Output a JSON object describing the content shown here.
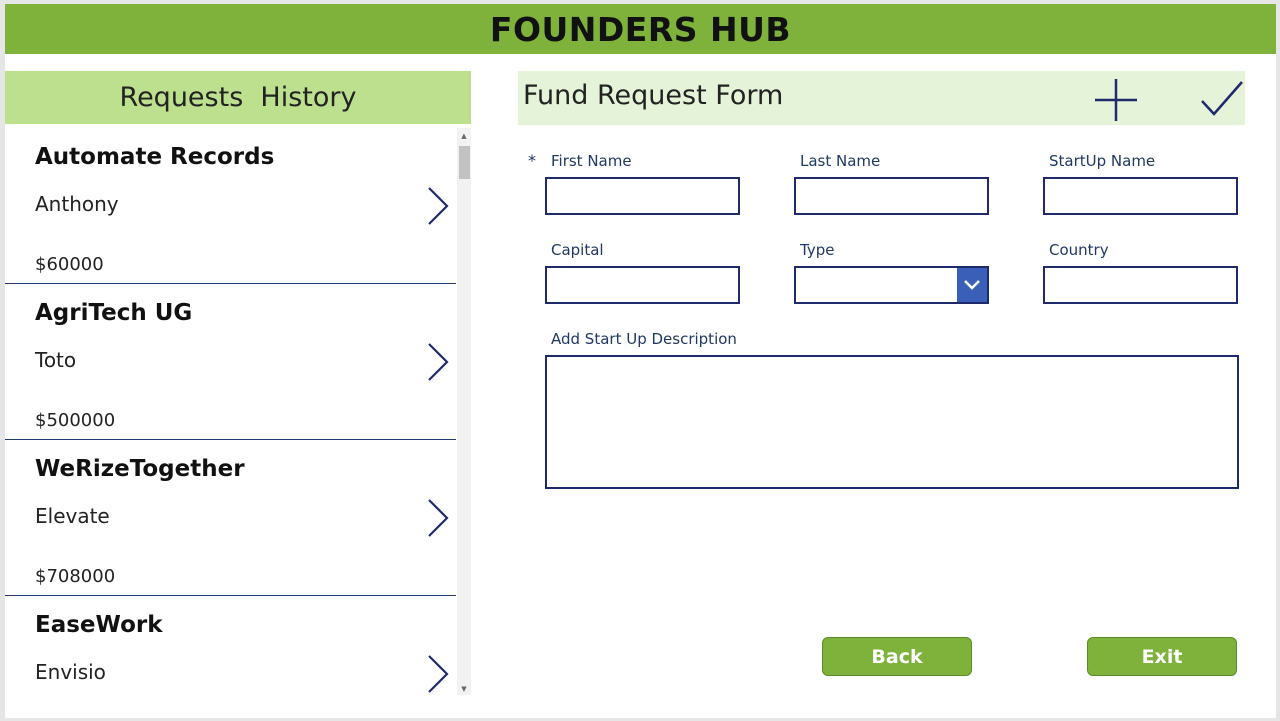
{
  "app": {
    "title": "FOUNDERS HUB"
  },
  "history": {
    "title": "Requests  History",
    "items": [
      {
        "title": "Automate Records",
        "name": "Anthony",
        "amount": "$60000"
      },
      {
        "title": "AgriTech UG",
        "name": "Toto",
        "amount": "$500000"
      },
      {
        "title": "WeRizeTogether",
        "name": "Elevate",
        "amount": "$708000"
      },
      {
        "title": "EaseWork",
        "name": "Envisio",
        "amount": ""
      }
    ]
  },
  "form": {
    "title": "Fund Request Form",
    "required_marker": "*",
    "fields": {
      "first_name": {
        "label": "First Name",
        "value": ""
      },
      "last_name": {
        "label": "Last Name",
        "value": ""
      },
      "startup_name": {
        "label": "StartUp Name",
        "value": ""
      },
      "capital": {
        "label": "Capital",
        "value": ""
      },
      "type": {
        "label": "Type",
        "value": ""
      },
      "country": {
        "label": "Country",
        "value": ""
      },
      "description": {
        "label": "Add Start Up Description",
        "value": ""
      }
    },
    "buttons": {
      "back": "Back",
      "exit": "Exit"
    }
  },
  "icons": {
    "add": "plus-icon",
    "submit": "checkmark-icon",
    "item_nav": "chevron-right-icon",
    "dropdown": "chevron-down-icon"
  },
  "colors": {
    "header_bg": "#7eb23b",
    "history_title_bg": "#bde08f",
    "form_title_bg": "#e5f3d9",
    "border_navy": "#1f2a6b",
    "dropdown_arrow_bg": "#3a5fb8"
  }
}
